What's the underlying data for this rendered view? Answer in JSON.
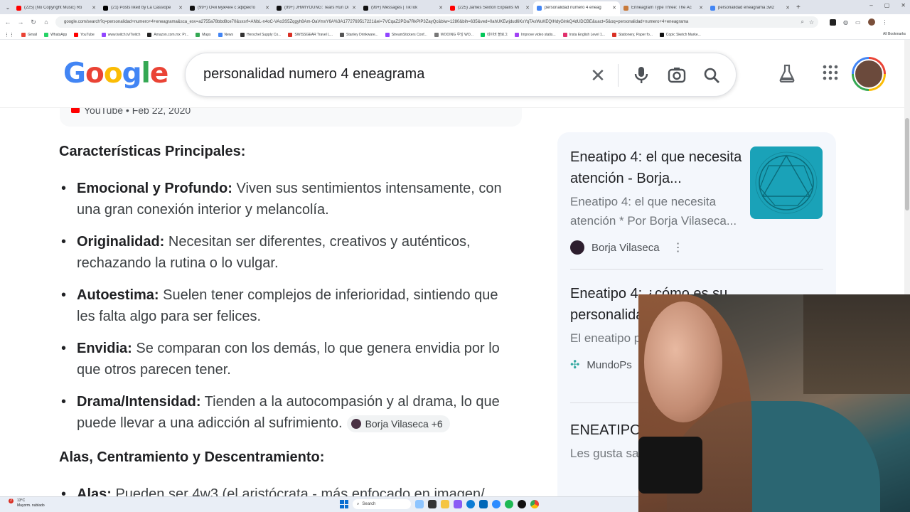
{
  "browser": {
    "tabs": [
      {
        "title": "(225) (No Copyright Music) Ro",
        "color": "#ff0000",
        "active": false
      },
      {
        "title": "(21) Posts liked by La Cassiope",
        "color": "#000000",
        "active": false
      },
      {
        "title": "(99+) Очи мужчин с эффекто",
        "color": "#111111",
        "active": false
      },
      {
        "title": "(99+) JHWIYOUNG: Tears Run Di",
        "color": "#111111",
        "active": false
      },
      {
        "title": "(99+) Messages | TikTok",
        "color": "#111111",
        "active": false
      },
      {
        "title": "(225) James Sexton Explains Mi",
        "color": "#ff0000",
        "active": false
      },
      {
        "title": "personalidad numero 4 eneag",
        "color": "#4285f4",
        "active": true
      },
      {
        "title": "Enneagram Type Three: The Ac",
        "color": "#c87a3a",
        "active": false
      },
      {
        "title": "personalidad eneagrama 3w2",
        "color": "#4285f4",
        "active": false
      }
    ],
    "url": "google.com/search?q=personalidad+numero+4+eneagrama&sca_esv=a2755a78bbd8ce70&sxsrf=ANbL-n4oC-VAo3S5Zqgyh8Am-OaVmxY6A%3A1772769517221&ei=7VCqaZ2PDa7RkPIP3ZayQc&biw=1280&bih=635&ved=0ahUKEwjdud6KxYqTAxWuKEQIHdyGlnkQ4dUDCBE&uact=5&oq=personalidad+numero+4+eneagrama",
    "bookmarks": [
      {
        "label": "Gmail",
        "color": "#ea4335"
      },
      {
        "label": "WhatsApp",
        "color": "#25d366"
      },
      {
        "label": "YouTube",
        "color": "#ff0000"
      },
      {
        "label": "www.twitch.tv/Twitch",
        "color": "#9146ff"
      },
      {
        "label": "Amazon.com.mx: Pr...",
        "color": "#222222"
      },
      {
        "label": "Maps",
        "color": "#34a853"
      },
      {
        "label": "News",
        "color": "#4285f4"
      },
      {
        "label": "Herschel Supply Co...",
        "color": "#333333"
      },
      {
        "label": "SWISSGEAR Travel L...",
        "color": "#d93025"
      },
      {
        "label": "Stanley Drinkware...",
        "color": "#555555"
      },
      {
        "label": "StreamStickers Conf...",
        "color": "#9146ff"
      },
      {
        "label": "WOOING 우잉 WO...",
        "color": "#777777"
      },
      {
        "label": "네이버 블로그",
        "color": "#03c75a"
      },
      {
        "label": "Improve video statis...",
        "color": "#a142f4"
      },
      {
        "label": "Insta English Level 1...",
        "color": "#e1306c"
      },
      {
        "label": "Stationery, Paper fo...",
        "color": "#d93025"
      },
      {
        "label": "Copic Sketch Marke...",
        "color": "#111111"
      }
    ],
    "all_bookmarks": "All Bookmarks"
  },
  "search": {
    "logo": "Google",
    "query": "personalidad numero 4 eneagrama"
  },
  "answer": {
    "yt_source": "YouTube • Feb 22, 2020",
    "heading1": "Características Principales:",
    "bullets": [
      {
        "term": "Emocional y Profundo:",
        "text": " Viven sus sentimientos intensamente, con una gran conexión interior y melancolía."
      },
      {
        "term": "Originalidad:",
        "text": " Necesitan ser diferentes, creativos y auténticos, rechazando la rutina o lo vulgar."
      },
      {
        "term": "Autoestima:",
        "text": " Suelen tener complejos de inferioridad, sintiendo que les falta algo para ser felices."
      },
      {
        "term": "Envidia:",
        "text": " Se comparan con los demás, lo que genera envidia por lo que otros parecen tener."
      },
      {
        "term": "Drama/Intensidad:",
        "text": " Tienden a la autocompasión y al drama, lo que puede llevar a una adicción al sufrimiento."
      }
    ],
    "source_chip": "Borja Vilaseca +6",
    "heading2": "Alas, Centramiento y Descentramiento:",
    "next_term": "Alas:",
    "next_text": " Pueden ser 4w3 (el aristócrata - más enfocado en imagen/"
  },
  "side_panel": {
    "cards": [
      {
        "title": "Eneatipo 4: el que necesita atención - Borja...",
        "snippet": "Eneatipo 4: el que necesita atención * Por Borja Vilaseca...",
        "source": "Borja Vilaseca"
      },
      {
        "title": "Eneatipo 4: ¿cómo es su personalidad",
        "snippet": "El eneatipo personalidad",
        "source": "MundoPs"
      },
      {
        "title": "ENEATIPO ENEAGRAM",
        "snippet": "Les gusta sa de los demá"
      }
    ]
  },
  "taskbar": {
    "weather_temp": "13°C",
    "weather_desc": "Mayorm. nublado",
    "notif_count": "2",
    "search_label": "Search"
  }
}
